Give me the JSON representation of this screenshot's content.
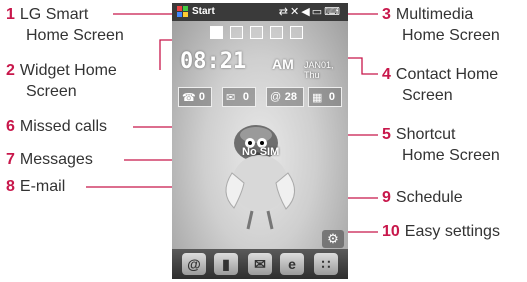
{
  "callouts": [
    {
      "num": "1",
      "lines": [
        "LG Smart",
        "Home Screen"
      ]
    },
    {
      "num": "2",
      "lines": [
        "Widget Home",
        "Screen"
      ]
    },
    {
      "num": "6",
      "lines": [
        "Missed calls"
      ]
    },
    {
      "num": "7",
      "lines": [
        "Messages"
      ]
    },
    {
      "num": "8",
      "lines": [
        "E-mail"
      ]
    },
    {
      "num": "3",
      "lines": [
        "Multimedia",
        "Home Screen"
      ]
    },
    {
      "num": "4",
      "lines": [
        "Contact Home",
        "Screen"
      ]
    },
    {
      "num": "5",
      "lines": [
        "Shortcut",
        "Home Screen"
      ]
    },
    {
      "num": "9",
      "lines": [
        "Schedule"
      ]
    },
    {
      "num": "10",
      "lines": [
        "Easy settings"
      ]
    }
  ],
  "phone": {
    "start_label": "Start",
    "time": "08:21",
    "ampm": "AM",
    "date": "JAN01, Thu",
    "no_sim": "No SIM",
    "widgets": {
      "missed_calls": "0",
      "messages": "0",
      "email": "28",
      "schedule": "0"
    },
    "accent_color": "#c8174b"
  }
}
